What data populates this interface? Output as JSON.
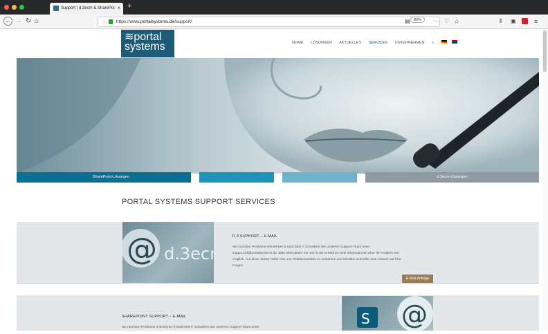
{
  "browser": {
    "tab_title": "Support | d.3ecm & SharePoi",
    "url_prefix": "https://www.",
    "url_domain": "portalsystems.de",
    "url_path": "/support/",
    "zoom": "80%",
    "toolbar_icons": [
      "reader-icon",
      "more-icon",
      "pocket-icon",
      "bookmark-star-icon",
      "library-icon",
      "sidebar-icon",
      "pdf-icon",
      "menu-icon"
    ]
  },
  "site": {
    "logo_line1": "≋portal",
    "logo_line2": "systems",
    "nav": [
      "HOME",
      "LÖSUNGEN",
      "AKTUELLES",
      "SERVICES",
      "UNTERNEHMEN"
    ],
    "active_nav": "SERVICES",
    "bands": [
      "SharePoint-Lösungen",
      "",
      "",
      "d.3ecm-Lösungen"
    ],
    "page_title": "PORTAL SYSTEMS SUPPORT SERVICES",
    "section1": {
      "title": "D.3 SUPPORT – E-MAIL",
      "lines": [
        "Sie möchten Probleme schnell per E-Mail lösen? Schreiben Sie unserem Support-Team unter",
        "support.d3@portalsystems.de. Bitte übermitteln Sie uns in der E-Mail so viele Informationen über Ihr Problem wie",
        "möglich. Auf diese Weise helfen Sie uns Reaktionszeiten zu verkürzen und erhalten schneller eine Antwort auf Ihre",
        "Fragen."
      ],
      "button": "E-Mail-Anfrage",
      "image_label": "d.3ecm"
    },
    "section2": {
      "title": "SHAREPOINT SUPPORT – E-MAIL",
      "lines": [
        "Sie möchten Probleme schnell per E-Mail lösen? Schreiben Sie unserem Support-Team unter"
      ]
    }
  },
  "colors": {
    "brand": "#1e5b77",
    "band_blue": "#0b6f93",
    "band_cyan": "#1e95b8",
    "band_light": "#6fb2cc",
    "band_grey": "#8f9aa2",
    "button": "#9c7c54"
  }
}
